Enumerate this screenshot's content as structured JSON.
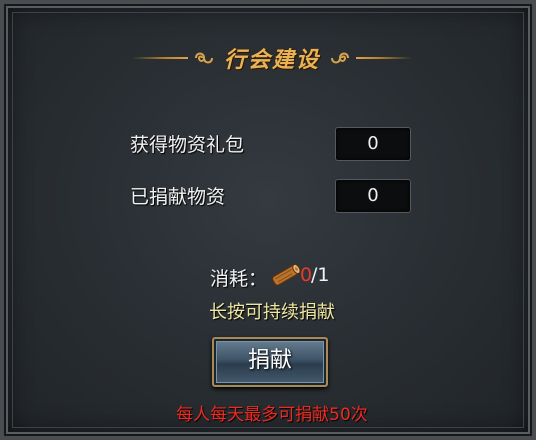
{
  "title": "行会建设",
  "rows": [
    {
      "label": "获得物资礼包",
      "value": "0"
    },
    {
      "label": "已捐献物资",
      "value": "0"
    }
  ],
  "cost": {
    "label": "消耗：",
    "have": "0",
    "need": "/1",
    "icon": "wood-log-icon"
  },
  "hint": "长按可持续捐献",
  "donate_button": "捐献",
  "limit_notice": "每人每天最多可捐献50次",
  "colors": {
    "title": "#e8b357",
    "hint": "#f0e7a0",
    "warning": "#ee2a20",
    "cost_have": "#e83a2a"
  }
}
